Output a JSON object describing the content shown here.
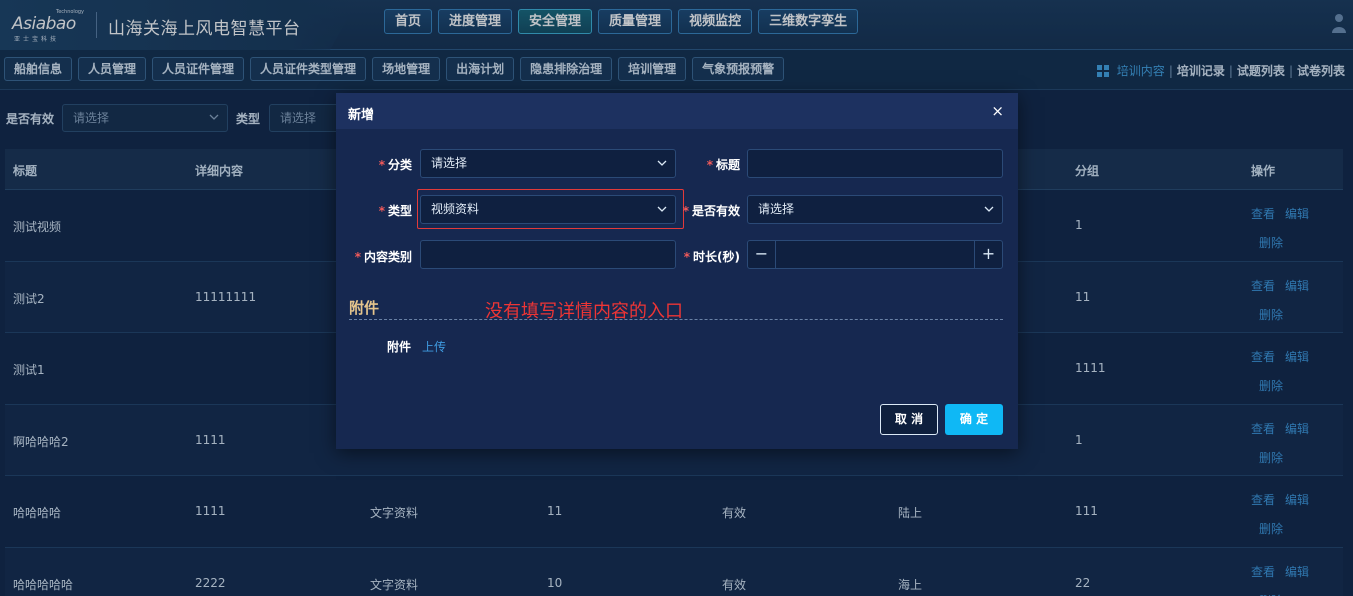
{
  "header": {
    "logo_text": "Asiabao",
    "logo_sub": "亚士宝科技",
    "logo_tech": "Technology",
    "platform_title": "山海关海上风电智慧平台",
    "nav": [
      {
        "label": "首页"
      },
      {
        "label": "进度管理"
      },
      {
        "label": "安全管理",
        "active": true
      },
      {
        "label": "质量管理"
      },
      {
        "label": "视频监控"
      },
      {
        "label": "三维数字孪生"
      }
    ]
  },
  "subnav": {
    "items": [
      "船舶信息",
      "人员管理",
      "人员证件管理",
      "人员证件类型管理",
      "场地管理",
      "出海计划",
      "隐患排除治理",
      "培训管理",
      "气象预报预警"
    ],
    "right_links": [
      {
        "label": "培训内容",
        "active": true
      },
      {
        "label": "培训记录"
      },
      {
        "label": "试题列表"
      },
      {
        "label": "试卷列表"
      }
    ]
  },
  "filter": {
    "valid_label": "是否有效",
    "valid_placeholder": "请选择",
    "type_label": "类型",
    "type_placeholder": "请选择"
  },
  "table": {
    "headers": {
      "title": "标题",
      "detail": "详细内容",
      "group": "分组",
      "ops": "操作"
    },
    "rows": [
      {
        "title": "测试视频",
        "detail": "",
        "type": "",
        "duration": "",
        "valid": "",
        "category": "",
        "group": "1"
      },
      {
        "title": "测试2",
        "detail": "11111111",
        "type": "",
        "duration": "",
        "valid": "",
        "category": "",
        "group": "11"
      },
      {
        "title": "测试1",
        "detail": "",
        "type": "",
        "duration": "",
        "valid": "",
        "category": "",
        "group": "1111"
      },
      {
        "title": "啊哈哈哈2",
        "detail": "1111",
        "type": "",
        "duration": "",
        "valid": "",
        "category": "",
        "group": "1"
      },
      {
        "title": "哈哈哈哈",
        "detail": "1111",
        "type": "文字资料",
        "duration": "11",
        "valid": "有效",
        "category": "陆上",
        "group": "111"
      },
      {
        "title": "哈哈哈哈哈",
        "detail": "2222",
        "type": "文字资料",
        "duration": "10",
        "valid": "有效",
        "category": "海上",
        "group": "22"
      }
    ],
    "op_view": "查看",
    "op_edit": "编辑",
    "op_delete": "删除"
  },
  "modal": {
    "title": "新增",
    "close": "×",
    "fields": {
      "category_label": "分类",
      "category_value": "请选择",
      "title_label": "标题",
      "title_value": "",
      "type_label": "类型",
      "type_value": "视频资料",
      "valid_label": "是否有效",
      "valid_value": "请选择",
      "content_type_label": "内容类别",
      "content_type_value": "",
      "duration_label": "时长(秒)",
      "duration_value": "",
      "required_mark": "*"
    },
    "stepper_minus": "−",
    "stepper_plus": "+",
    "section_title": "附件",
    "annotation": "没有填写详情内容的入口",
    "attach_label": "附件",
    "upload": "上传",
    "cancel": "取 消",
    "ok": "确 定"
  },
  "colors": {
    "accent": "#0fb8f5",
    "link": "#3f9be0",
    "required": "#f25a5a",
    "annotation": "#ee3535",
    "section_title": "#e5c58d"
  }
}
